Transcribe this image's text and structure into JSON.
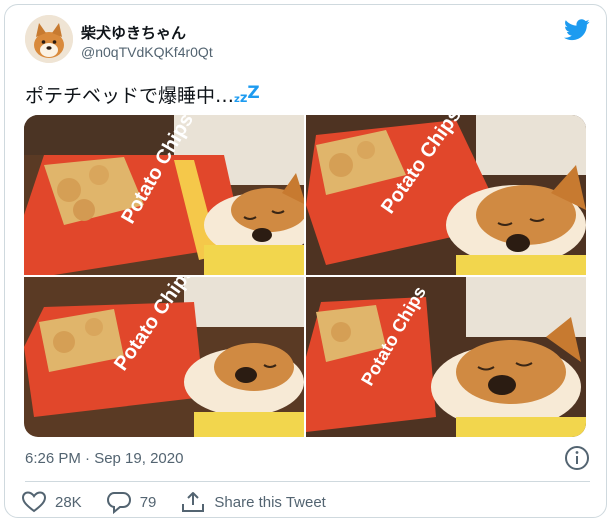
{
  "user": {
    "display_name": "柴犬ゆきちゃん",
    "handle": "@n0qTVdKQKf4r0Qt",
    "avatar_icon": "shiba-avatar",
    "logo_icon": "twitter-bird-icon"
  },
  "tweet": {
    "text": "ポテチベッドで爆睡中…",
    "zzz": [
      "z",
      "z",
      "Z"
    ],
    "timestamp": "6:26 PM · Sep 19, 2020"
  },
  "media": {
    "photos": [
      {
        "bag_text": "Potato Chips"
      },
      {
        "bag_text": "Potato Chips"
      },
      {
        "bag_text": "Potato Chips"
      },
      {
        "bag_text": "Potato Chips"
      }
    ]
  },
  "actions": {
    "like_count": "28K",
    "reply_count": "79",
    "share_label": "Share this Tweet"
  },
  "colors": {
    "brand": "#1d9bf0",
    "text_secondary": "#536471",
    "border": "#cfd9de"
  }
}
